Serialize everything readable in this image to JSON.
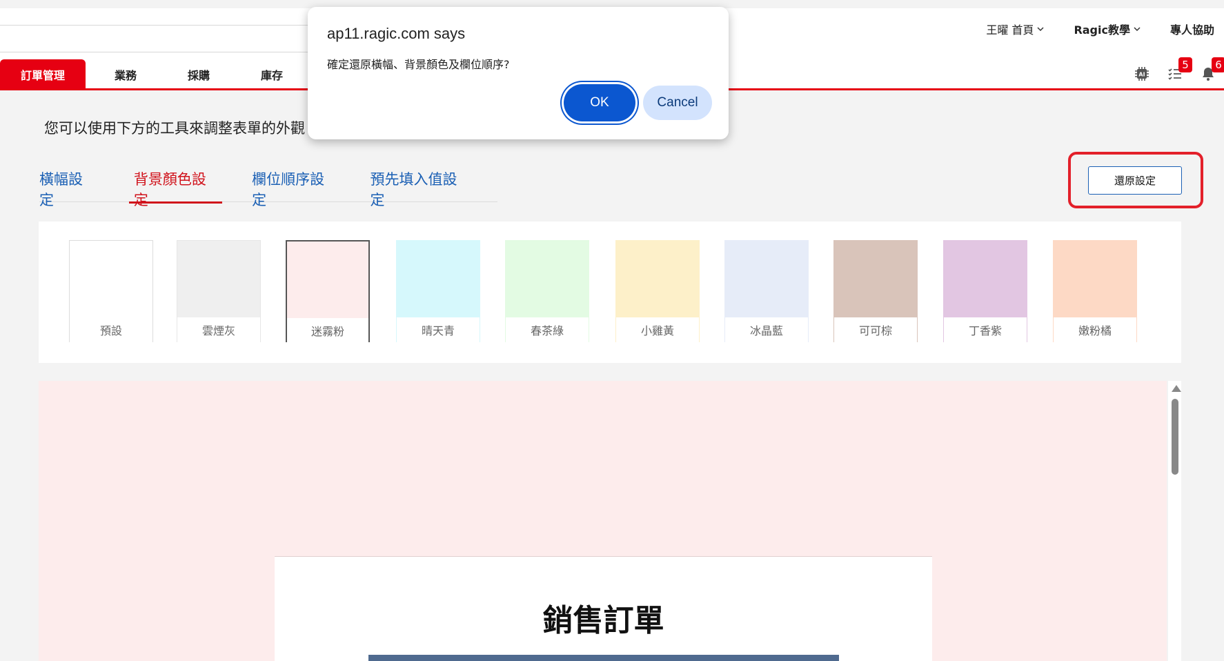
{
  "header": {
    "user_menu": [
      {
        "label": "王曜 首頁",
        "has_dropdown": true
      },
      {
        "label": "Ragic教學",
        "has_dropdown": true
      },
      {
        "label": "專人協助",
        "has_dropdown": false
      }
    ],
    "nav_tabs": [
      {
        "label": "訂單管理",
        "active": true
      },
      {
        "label": "業務",
        "active": false
      },
      {
        "label": "採購",
        "active": false
      },
      {
        "label": "庫存",
        "active": false
      }
    ],
    "icons": {
      "ai": {
        "name": "ai-chip-icon"
      },
      "tasks": {
        "name": "task-list-icon",
        "badge": "5"
      },
      "notifications": {
        "name": "bell-icon",
        "badge": "6"
      }
    },
    "accent_color": "#e60012"
  },
  "main": {
    "intro_text": "您可以使用下方的工具來調整表單的外觀",
    "settings_tabs": [
      {
        "label": "橫幅設定",
        "active": false
      },
      {
        "label": "背景顏色設定",
        "active": true
      },
      {
        "label": "欄位順序設定",
        "active": false
      },
      {
        "label": "預先填入值設定",
        "active": false
      }
    ],
    "restore_button_label": "還原設定",
    "swatches": [
      {
        "label": "預設",
        "color": "#ffffff",
        "border": "#dcdcdc",
        "selected": false
      },
      {
        "label": "雲煙灰",
        "color": "#efefef",
        "border": "#e6e6e6",
        "selected": false
      },
      {
        "label": "迷霧粉",
        "color": "#fdecec",
        "border": "#555555",
        "selected": true
      },
      {
        "label": "晴天青",
        "color": "#d6f8fc",
        "border": "#d6f8fc",
        "selected": false
      },
      {
        "label": "春茶綠",
        "color": "#e3fbe3",
        "border": "#e3fbe3",
        "selected": false
      },
      {
        "label": "小雞黃",
        "color": "#fdf0c9",
        "border": "#fdf0c9",
        "selected": false
      },
      {
        "label": "冰晶藍",
        "color": "#e6ecf8",
        "border": "#e6ecf8",
        "selected": false
      },
      {
        "label": "可可棕",
        "color": "#d9c4ba",
        "border": "#d9c4ba",
        "selected": false
      },
      {
        "label": "丁香紫",
        "color": "#e2c6e2",
        "border": "#e2c6e2",
        "selected": false
      },
      {
        "label": "嫩粉橘",
        "color": "#fdd9c5",
        "border": "#fdd9c5",
        "selected": false
      }
    ],
    "preview": {
      "background": "#fdecec",
      "form_title": "銷售訂單"
    }
  },
  "dialog": {
    "title": "ap11.ragic.com says",
    "message": "確定還原橫幅、背景顏色及欄位順序?",
    "ok_label": "OK",
    "cancel_label": "Cancel"
  }
}
